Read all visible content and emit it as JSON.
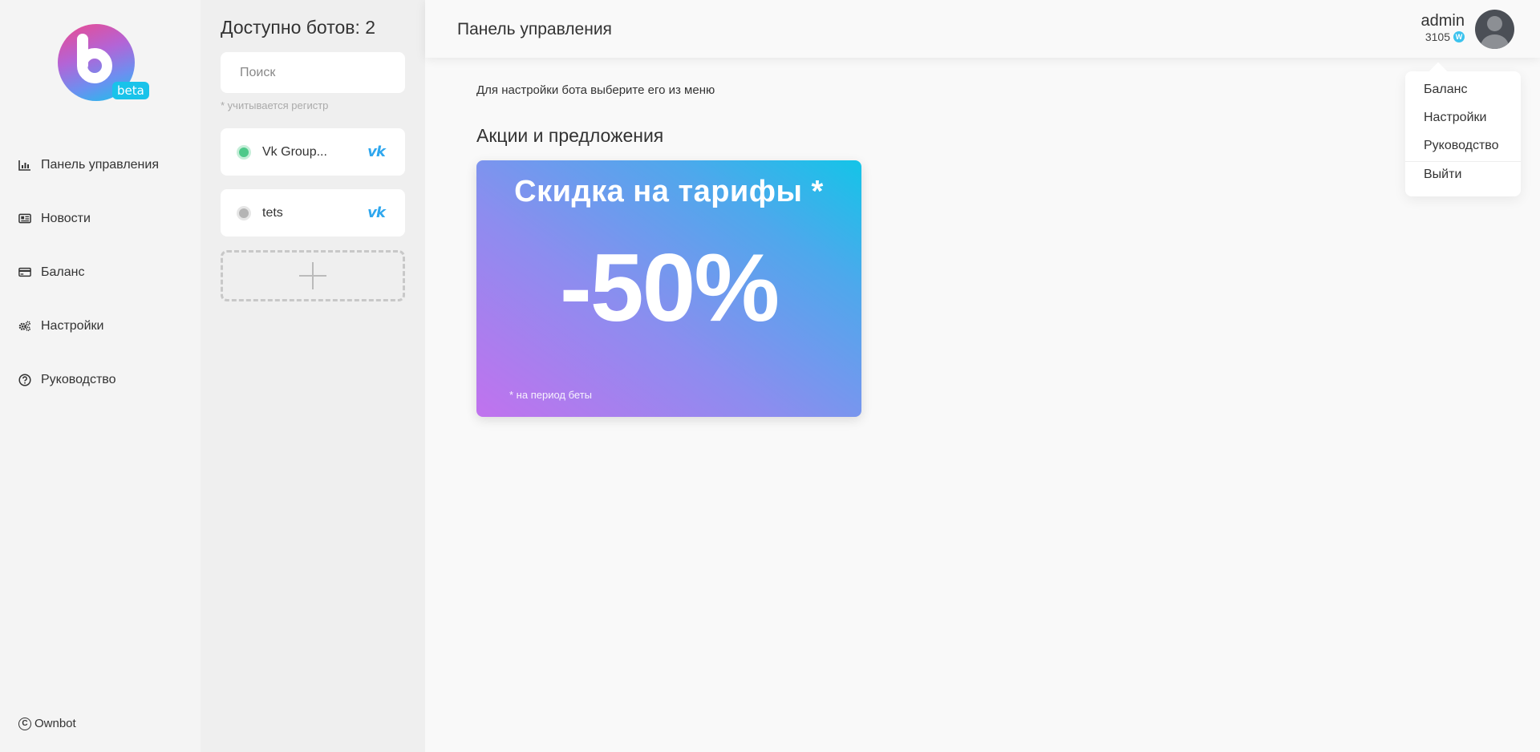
{
  "logo": {
    "badge": "beta"
  },
  "sidebar": {
    "items": [
      {
        "label": "Панель управления",
        "icon": "chart-icon"
      },
      {
        "label": "Новости",
        "icon": "newspaper-icon"
      },
      {
        "label": "Баланс",
        "icon": "credit-card-icon"
      },
      {
        "label": "Настройки",
        "icon": "gears-icon"
      },
      {
        "label": "Руководство",
        "icon": "question-circle-icon"
      }
    ],
    "footer": "Ownbot"
  },
  "bots": {
    "title": "Доступно ботов: 2",
    "search_placeholder": "Поиск",
    "hint": "* учитывается регистр",
    "list": [
      {
        "name": "Vk Group...",
        "status": "online",
        "platform": "vk"
      },
      {
        "name": "tets",
        "status": "offline",
        "platform": "vk"
      }
    ]
  },
  "header": {
    "title": "Панель управления",
    "user": {
      "name": "admin",
      "balance": "3105"
    }
  },
  "dropdown": {
    "items": [
      "Баланс",
      "Настройки",
      "Руководство",
      "Выйти"
    ]
  },
  "main": {
    "hint": "Для настройки бота выберите его из меню",
    "section_title": "Акции и предложения",
    "promo": {
      "title": "Скидка на тарифы *",
      "value": "-50%",
      "note": "* на период беты"
    }
  },
  "colors": {
    "accent": "#19c3ea",
    "online": "#4ec98a",
    "offline": "#b4b4b4",
    "vk": "#2fa7ee"
  }
}
